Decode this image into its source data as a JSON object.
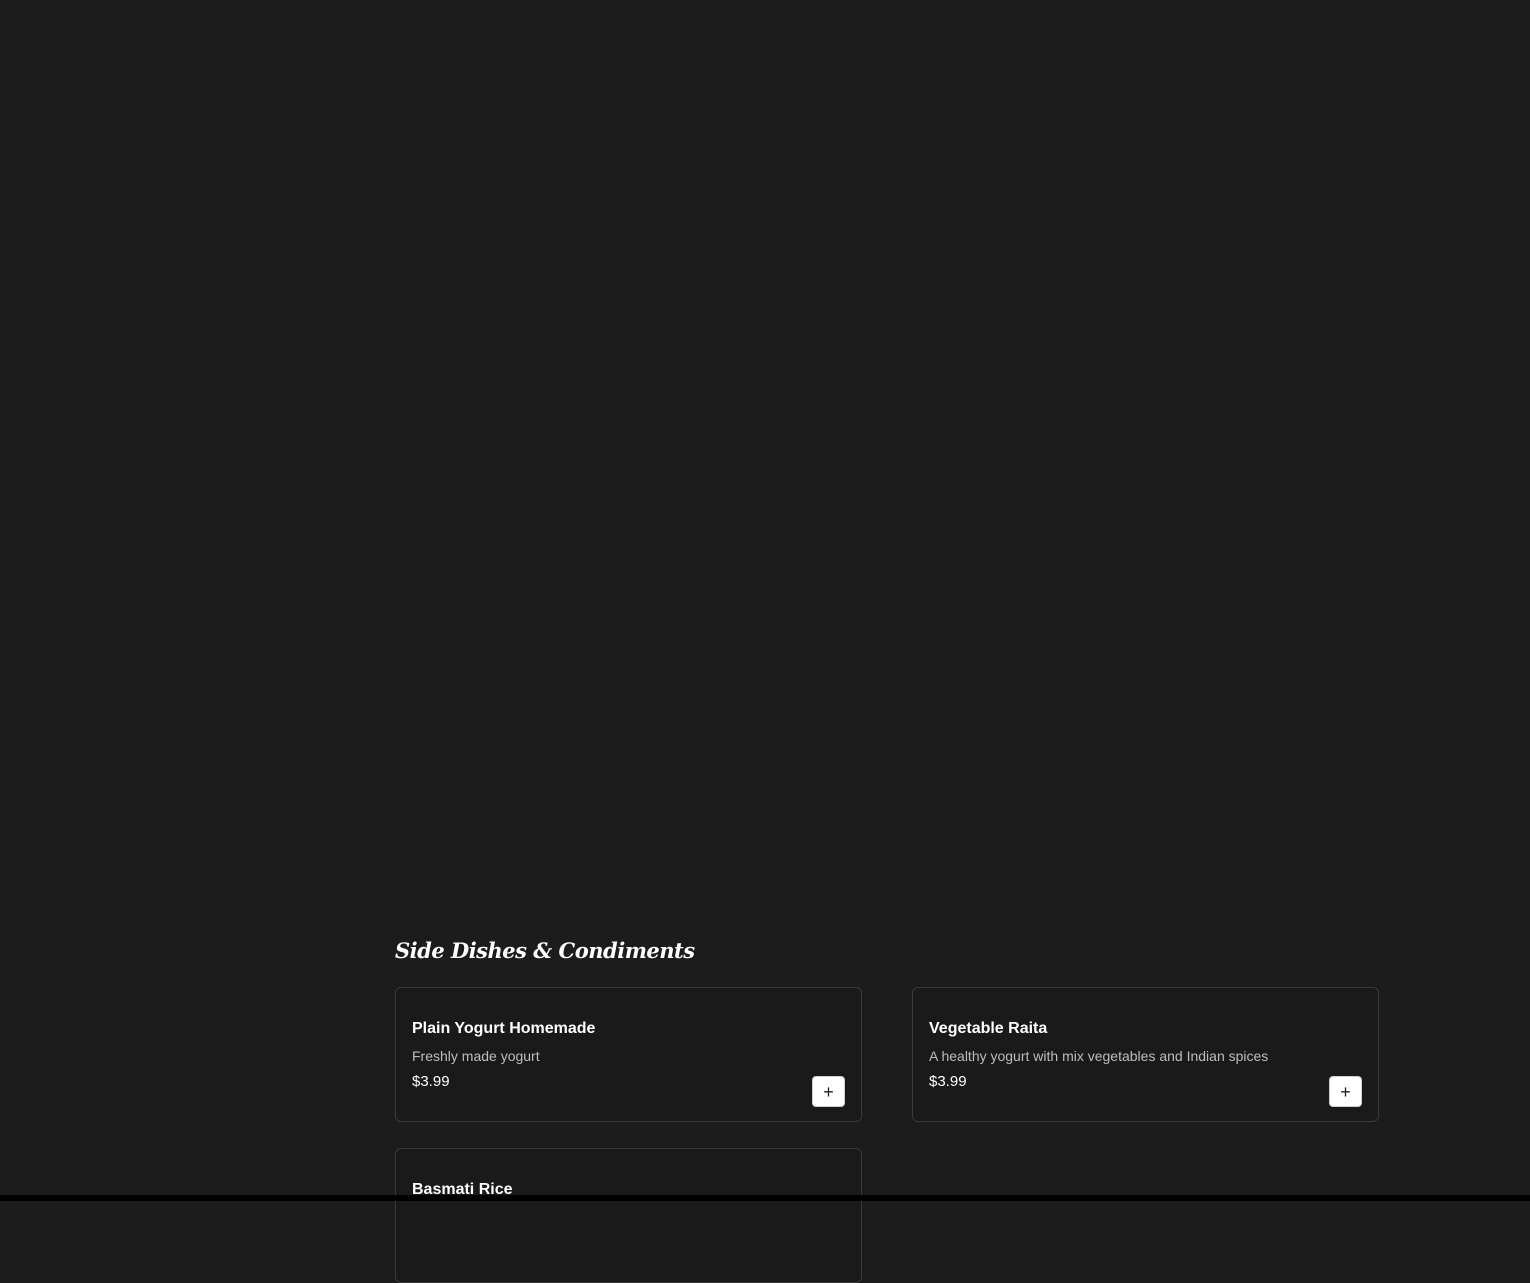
{
  "section": {
    "title": "Side Dishes & Condiments"
  },
  "items": [
    {
      "name": "Plain Yogurt Homemade",
      "description": "Freshly made yogurt",
      "price": "$3.99",
      "add_label": "+"
    },
    {
      "name": "Vegetable Raita",
      "description": "A healthy yogurt with mix vegetables and Indian spices",
      "price": "$3.99",
      "add_label": "+"
    },
    {
      "name": "Basmati Rice"
    }
  ],
  "colors": {
    "background": "#1c1c1c",
    "card_border": "#3a3a3a",
    "button_background": "#ffffff"
  }
}
